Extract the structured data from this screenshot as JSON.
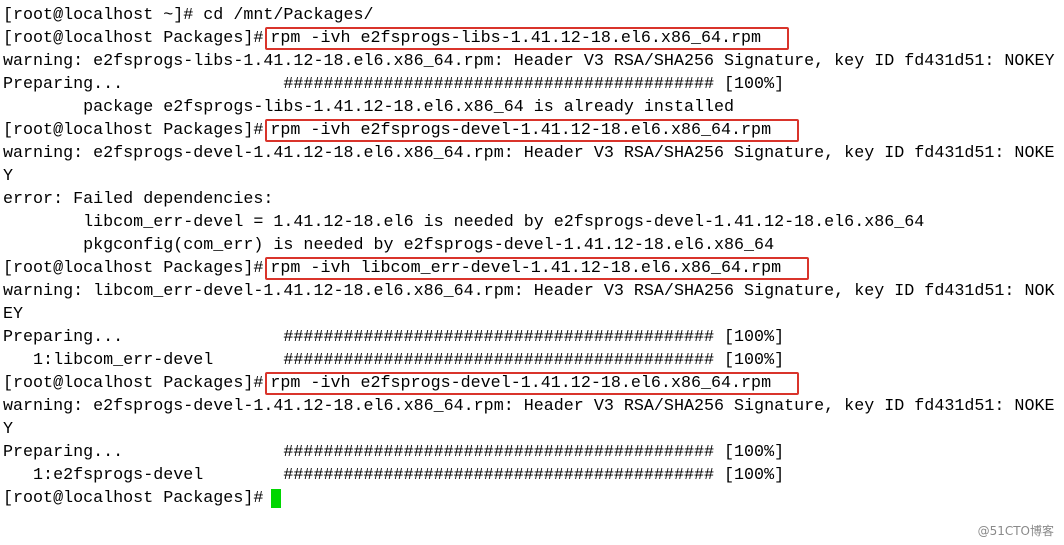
{
  "terminal": {
    "lines": [
      "[root@localhost ~]# cd /mnt/Packages/",
      "[root@localhost Packages]#",
      "warning: e2fsprogs-libs-1.41.12-18.el6.x86_64.rpm: Header V3 RSA/SHA256 Signature, key ID fd431d51: NOKEY",
      "Preparing...                ########################################### [100%]",
      "        package e2fsprogs-libs-1.41.12-18.el6.x86_64 is already installed",
      "[root@localhost Packages]#",
      "warning: e2fsprogs-devel-1.41.12-18.el6.x86_64.rpm: Header V3 RSA/SHA256 Signature, key ID fd431d51: NOKE",
      "Y",
      "error: Failed dependencies:",
      "        libcom_err-devel = 1.41.12-18.el6 is needed by e2fsprogs-devel-1.41.12-18.el6.x86_64",
      "        pkgconfig(com_err) is needed by e2fsprogs-devel-1.41.12-18.el6.x86_64",
      "[root@localhost Packages]#",
      "warning: libcom_err-devel-1.41.12-18.el6.x86_64.rpm: Header V3 RSA/SHA256 Signature, key ID fd431d51: NOK",
      "EY",
      "Preparing...                ########################################### [100%]",
      "   1:libcom_err-devel       ########################################### [100%]",
      "[root@localhost Packages]#",
      "warning: e2fsprogs-devel-1.41.12-18.el6.x86_64.rpm: Header V3 RSA/SHA256 Signature, key ID fd431d51: NOKE",
      "Y",
      "Preparing...                ########################################### [100%]",
      "   1:e2fsprogs-devel        ########################################### [100%]",
      "[root@localhost Packages]#"
    ],
    "commands": {
      "cmd1": "rpm -ivh e2fsprogs-libs-1.41.12-18.el6.x86_64.rpm",
      "cmd2": "rpm -ivh e2fsprogs-devel-1.41.12-18.el6.x86_64.rpm",
      "cmd3": "rpm -ivh libcom_err-devel-1.41.12-18.el6.x86_64.rpm",
      "cmd4": "rpm -ivh e2fsprogs-devel-1.41.12-18.el6.x86_64.rpm"
    },
    "highlight_color": "#d9342b",
    "cursor_color": "#00d600"
  },
  "watermark": "@51CTO博客"
}
